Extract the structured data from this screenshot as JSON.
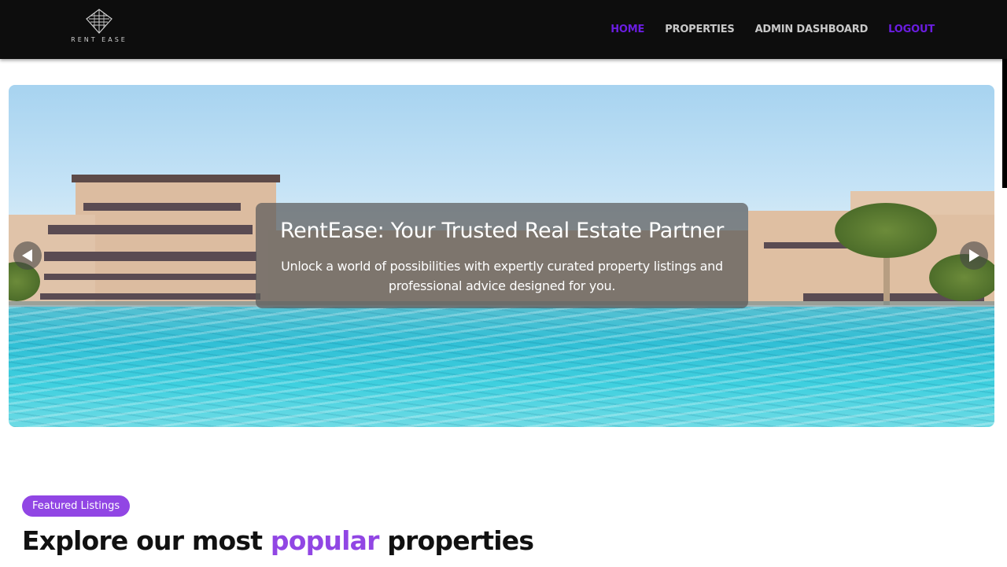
{
  "brand": {
    "logo_text": "RENT EASE"
  },
  "nav": {
    "items": [
      {
        "label": "HOME"
      },
      {
        "label": "PROPERTIES"
      },
      {
        "label": "ADMIN DASHBOARD"
      },
      {
        "label": "LOGOUT"
      }
    ],
    "active_color": "#6a1de0",
    "default_color": "#c8c8c8"
  },
  "hero": {
    "title": "RentEase: Your Trusted Real Estate Partner",
    "subtitle": "Unlock a world of possibilities with expertly curated property listings and professional advice designed for you.",
    "prev_icon": "arrow-left-icon",
    "next_icon": "arrow-right-icon"
  },
  "featured": {
    "badge": "Featured Listings",
    "headline_before": "Explore our most ",
    "headline_highlight": "popular",
    "headline_after": " properties",
    "accent_color": "#9146e4"
  }
}
